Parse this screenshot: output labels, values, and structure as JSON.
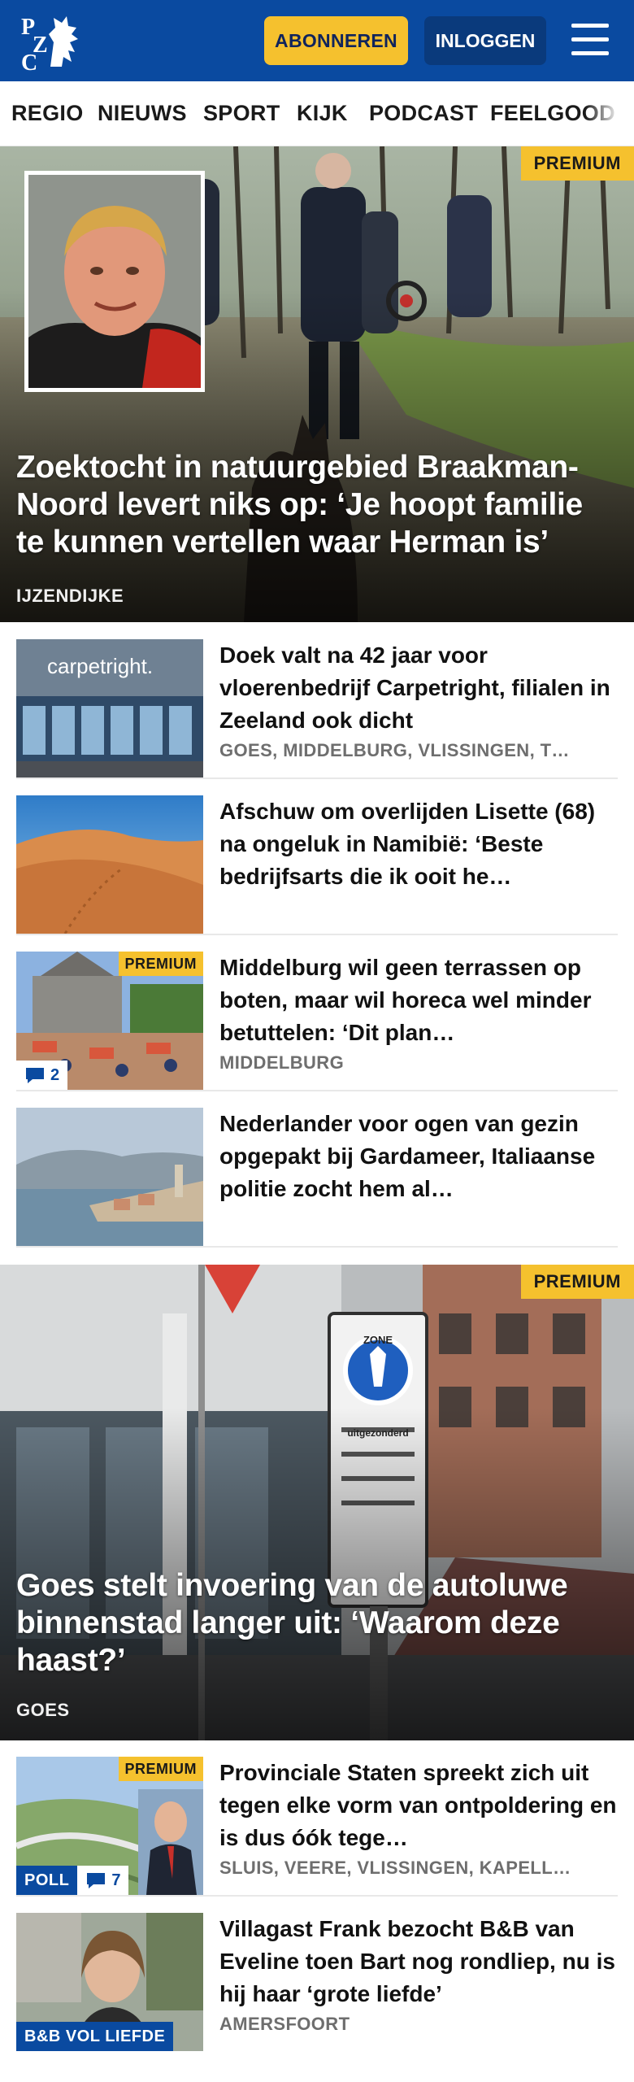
{
  "header": {
    "logo_text": "PZC",
    "subscribe_label": "ABONNEREN",
    "login_label": "INLOGGEN",
    "menu_icon": "hamburger-menu-icon",
    "brand_color": "#0a4aa0",
    "accent_color": "#f5c12e"
  },
  "nav": {
    "items": [
      "REGIO",
      "NIEUWS",
      "SPORT",
      "KIJK",
      "PODCAST",
      "FEELGOOD"
    ]
  },
  "premium_label": "PREMIUM",
  "hero1": {
    "title": "Zoektocht in natuurgebied Braakman-Noord levert niks op: ‘Je hoopt familie te kunnen vertellen waar Herman is’",
    "location": "IJZENDIJKE",
    "premium": true
  },
  "list1": [
    {
      "title": "Doek valt na 42 jaar voor vloerenbedrijf Carpetright, filialen in Zeeland ook dicht",
      "location": "GOES, MIDDELBURG, VLISSINGEN, T…",
      "image": "carpetright-storefront"
    },
    {
      "title": "Afschuw om overlijden Lisette (68) na ongeluk in Namibië: ‘Beste bedrijfsarts die ik ooit he…",
      "location": "",
      "image": "desert-dunes"
    },
    {
      "title": "Middelburg wil geen terrassen op boten, maar wil horeca wel minder betuttelen: ‘Dit plan…",
      "location": "MIDDELBURG",
      "premium": true,
      "comments": "2",
      "image": "middelburg-market-square"
    },
    {
      "title": "Nederlander voor ogen van gezin opgepakt bij Gardameer, Italiaanse politie zocht hem al…",
      "location": "",
      "image": "lake-garda-shore"
    }
  ],
  "hero2": {
    "title": "Goes stelt invoering van de autoluwe binnenstad langer uit: ‘Waarom deze haast?’",
    "location": "GOES",
    "premium": true,
    "sign_zone": "ZONE",
    "sign_text": "uitgezonderd"
  },
  "list2": [
    {
      "title": "Provinciale Staten spreekt zich uit tegen elke vorm van ontpoldering en is dus óók tege…",
      "location": "SLUIS, VEERE, VLISSINGEN, KAPELL…",
      "premium": true,
      "tag": "POLL",
      "comments": "7",
      "image": "dike-and-politician"
    },
    {
      "title": "Villagast Frank bezocht B&B van Eveline toen Bart nog rondliep, nu is hij haar ‘grote liefde’",
      "location": "AMERSFOORT",
      "tag": "B&B VOL LIEFDE",
      "image": "woman-portrait"
    }
  ]
}
